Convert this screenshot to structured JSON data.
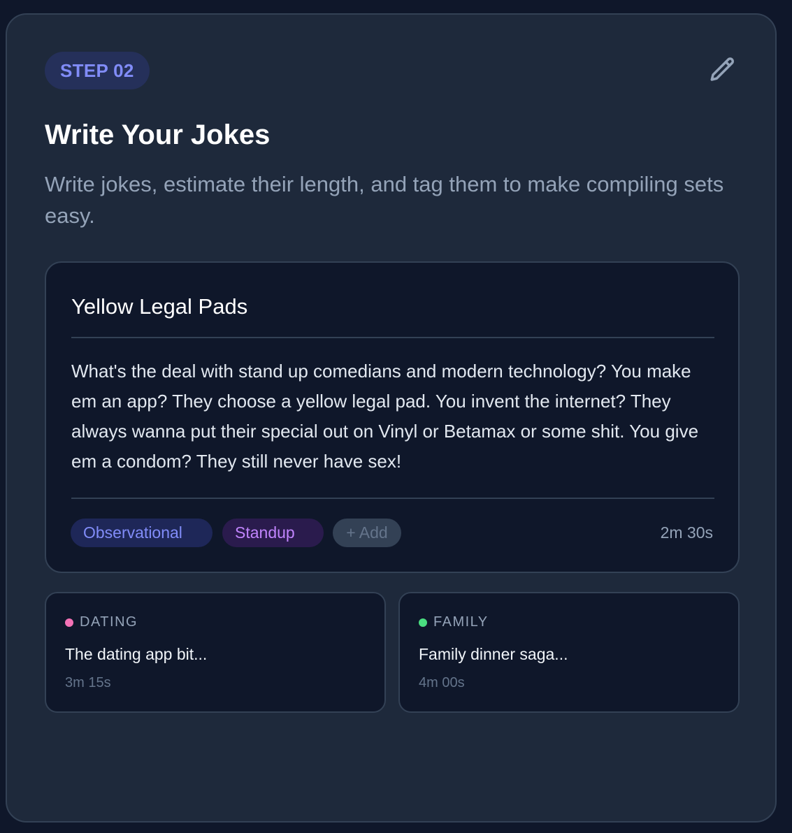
{
  "step": {
    "label": "STEP 02"
  },
  "header": {
    "title": "Write Your Jokes",
    "subtitle": "Write jokes, estimate their length, and tag them to make compiling sets easy.",
    "edit_icon": "pencil-icon"
  },
  "joke": {
    "title": "Yellow Legal Pads",
    "body": "What's the deal with stand up comedians and modern technology? You make em an app? They choose a yellow legal pad. You invent the internet? They always wanna put their special out on Vinyl or Betamax or some shit. You give em a condom? They still never have sex!",
    "tags": [
      {
        "label": "Observational",
        "color": "#818cf8"
      },
      {
        "label": "Standup",
        "color": "#c084fc"
      }
    ],
    "add_tag_label": "+ Add",
    "duration": "2m 30s"
  },
  "other_jokes": [
    {
      "category": "DATING",
      "dot_color": "#f472b6",
      "title": "The dating app bit...",
      "duration": "3m 15s"
    },
    {
      "category": "FAMILY",
      "dot_color": "#4ade80",
      "title": "Family dinner saga...",
      "duration": "4m 00s"
    }
  ],
  "colors": {
    "background": "#0f172a",
    "card": "#1e293b",
    "accent": "#818cf8"
  }
}
